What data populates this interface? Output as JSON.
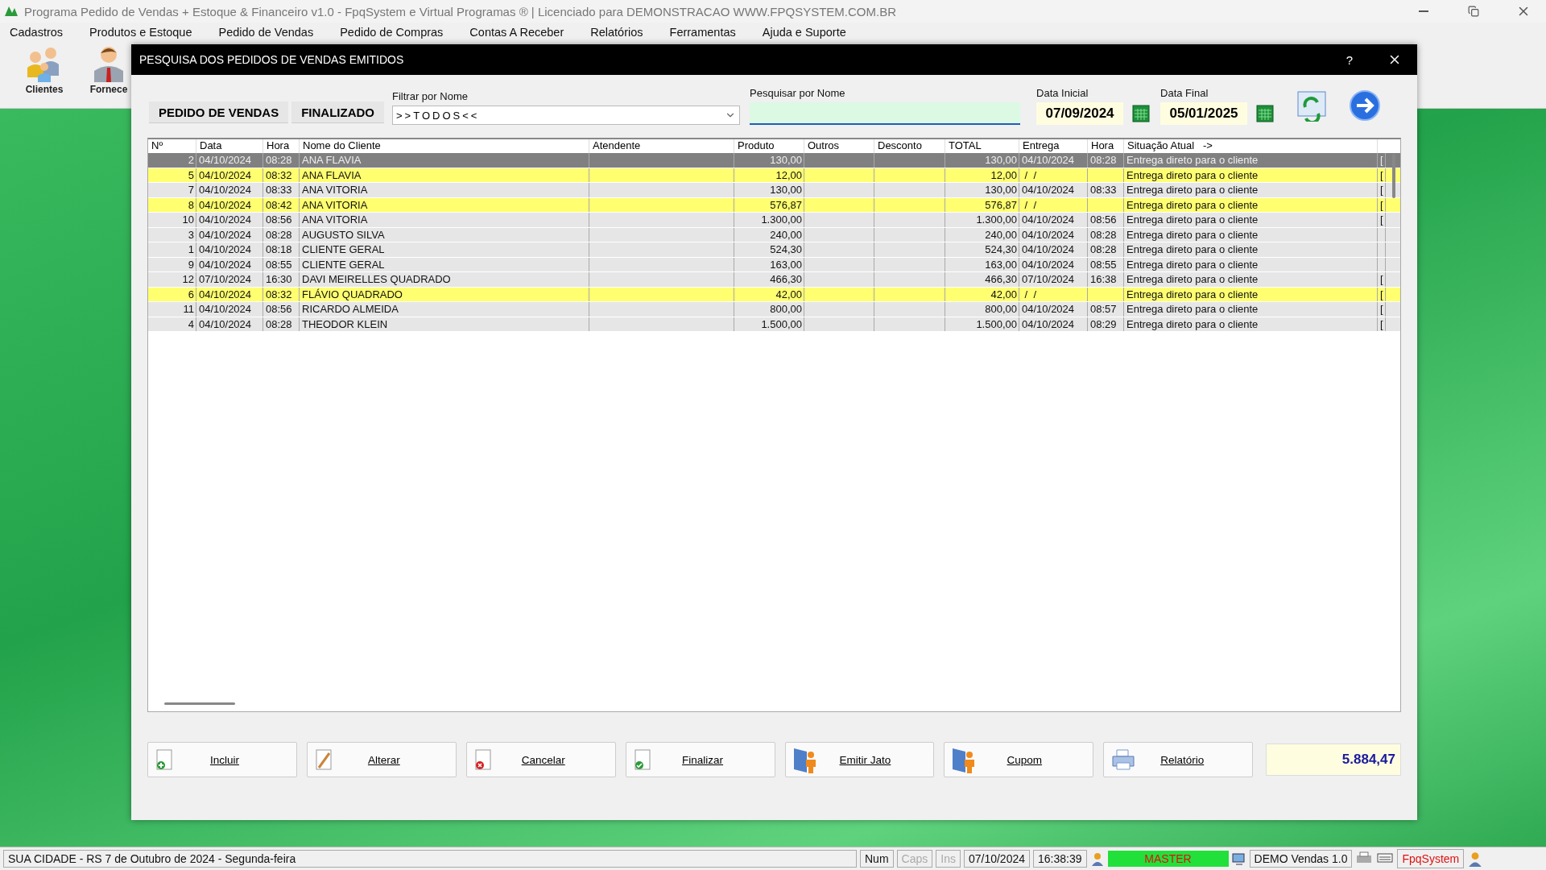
{
  "window": {
    "title": "Programa Pedido de Vendas + Estoque & Financeiro v1.0 - FpqSystem e Virtual Programas ® | Licenciado para  DEMONSTRACAO WWW.FPQSYSTEM.COM.BR"
  },
  "menu": [
    "Cadastros",
    "Produtos e Estoque",
    "Pedido de Vendas",
    "Pedido de Compras",
    "Contas A Receber",
    "Relatórios",
    "Ferramentas",
    "Ajuda e Suporte"
  ],
  "toolbar": [
    {
      "label": "Clientes",
      "kind": "people"
    },
    {
      "label": "Fornece",
      "kind": "person"
    }
  ],
  "dialog": {
    "title": "PESQUISA DOS PEDIDOS DE VENDAS EMITIDOS",
    "help": "?",
    "header_labels": [
      "PEDIDO DE VENDAS",
      "FINALIZADO"
    ],
    "filter": {
      "label": "Filtrar por Nome",
      "value": ">>TODOS<<"
    },
    "search": {
      "label": "Pesquisar por Nome"
    },
    "date_start": {
      "label": "Data Inicial",
      "value": "07/09/2024"
    },
    "date_end": {
      "label": "Data Final",
      "value": "05/01/2025"
    },
    "table": {
      "columns": [
        "Nº",
        "Data",
        "Hora",
        "Nome do Cliente",
        "Atendente",
        "Produto",
        "Outros",
        "Desconto",
        "TOTAL",
        "Entrega",
        "Hora",
        "Situação Atual   ->"
      ],
      "rows": [
        {
          "cells": [
            "2",
            "04/10/2024",
            "08:28",
            "ANA FLAVIA",
            "",
            "130,00",
            "",
            "",
            "130,00",
            "04/10/2024",
            "08:28",
            "Entrega direto para o cliente",
            "["
          ],
          "selected": true,
          "highlighted": false
        },
        {
          "cells": [
            "5",
            "04/10/2024",
            "08:32",
            "ANA FLAVIA",
            "",
            "12,00",
            "",
            "",
            "12,00",
            " /  /",
            "",
            "Entrega direto para o cliente",
            "["
          ],
          "selected": false,
          "highlighted": true
        },
        {
          "cells": [
            "7",
            "04/10/2024",
            "08:33",
            "ANA VITORIA",
            "",
            "130,00",
            "",
            "",
            "130,00",
            "04/10/2024",
            "08:33",
            "Entrega direto para o cliente",
            "["
          ],
          "selected": false,
          "highlighted": false
        },
        {
          "cells": [
            "8",
            "04/10/2024",
            "08:42",
            "ANA VITORIA",
            "",
            "576,87",
            "",
            "",
            "576,87",
            " /  /",
            "",
            "Entrega direto para o cliente",
            "["
          ],
          "selected": false,
          "highlighted": true
        },
        {
          "cells": [
            "10",
            "04/10/2024",
            "08:56",
            "ANA VITORIA",
            "",
            "1.300,00",
            "",
            "",
            "1.300,00",
            "04/10/2024",
            "08:56",
            "Entrega direto para o cliente",
            "["
          ],
          "selected": false,
          "highlighted": false
        },
        {
          "cells": [
            "3",
            "04/10/2024",
            "08:28",
            "AUGUSTO SILVA",
            "",
            "240,00",
            "",
            "",
            "240,00",
            "04/10/2024",
            "08:28",
            "Entrega direto para o cliente",
            ""
          ],
          "selected": false,
          "highlighted": false
        },
        {
          "cells": [
            "1",
            "04/10/2024",
            "08:18",
            "CLIENTE GERAL",
            "",
            "524,30",
            "",
            "",
            "524,30",
            "04/10/2024",
            "08:28",
            "Entrega direto para o cliente",
            ""
          ],
          "selected": false,
          "highlighted": false
        },
        {
          "cells": [
            "9",
            "04/10/2024",
            "08:55",
            "CLIENTE GERAL",
            "",
            "163,00",
            "",
            "",
            "163,00",
            "04/10/2024",
            "08:55",
            "Entrega direto para o cliente",
            ""
          ],
          "selected": false,
          "highlighted": false
        },
        {
          "cells": [
            "12",
            "07/10/2024",
            "16:30",
            "DAVI MEIRELLES QUADRADO",
            "",
            "466,30",
            "",
            "",
            "466,30",
            "07/10/2024",
            "16:38",
            "Entrega direto para o cliente",
            "["
          ],
          "selected": false,
          "highlighted": false
        },
        {
          "cells": [
            "6",
            "04/10/2024",
            "08:32",
            "FLÁVIO QUADRADO",
            "",
            "42,00",
            "",
            "",
            "42,00",
            " /  /",
            "",
            "Entrega direto para o cliente",
            "["
          ],
          "selected": false,
          "highlighted": true
        },
        {
          "cells": [
            "11",
            "04/10/2024",
            "08:56",
            "RICARDO ALMEIDA",
            "",
            "800,00",
            "",
            "",
            "800,00",
            "04/10/2024",
            "08:57",
            "Entrega direto para o cliente",
            "["
          ],
          "selected": false,
          "highlighted": false
        },
        {
          "cells": [
            "4",
            "04/10/2024",
            "08:28",
            "THEODOR KLEIN",
            "",
            "1.500,00",
            "",
            "",
            "1.500,00",
            "04/10/2024",
            "08:29",
            "Entrega direto para o cliente",
            "["
          ],
          "selected": false,
          "highlighted": false
        }
      ]
    },
    "buttons": [
      {
        "label": "Incluir",
        "kind": "add"
      },
      {
        "label": "Alterar",
        "kind": "edit"
      },
      {
        "label": "Cancelar",
        "kind": "cancel"
      },
      {
        "label": "Finalizar",
        "kind": "finish"
      },
      {
        "label": "Emitir Jato",
        "kind": "person"
      },
      {
        "label": "Cupom",
        "kind": "person"
      },
      {
        "label": "Relatório",
        "kind": "print"
      }
    ],
    "total": "5.884,47"
  },
  "status_bar": {
    "location": "SUA CIDADE - RS  7 de Outubro de 2024 - Segunda-feira",
    "keys": [
      {
        "label": "Num",
        "on": true
      },
      {
        "label": "Caps",
        "on": false
      },
      {
        "label": "Ins",
        "on": false
      }
    ],
    "date": "07/10/2024",
    "time": "16:38:39",
    "user": "MASTER",
    "version": "DEMO Vendas 1.0",
    "brand": "FpqSystem"
  }
}
